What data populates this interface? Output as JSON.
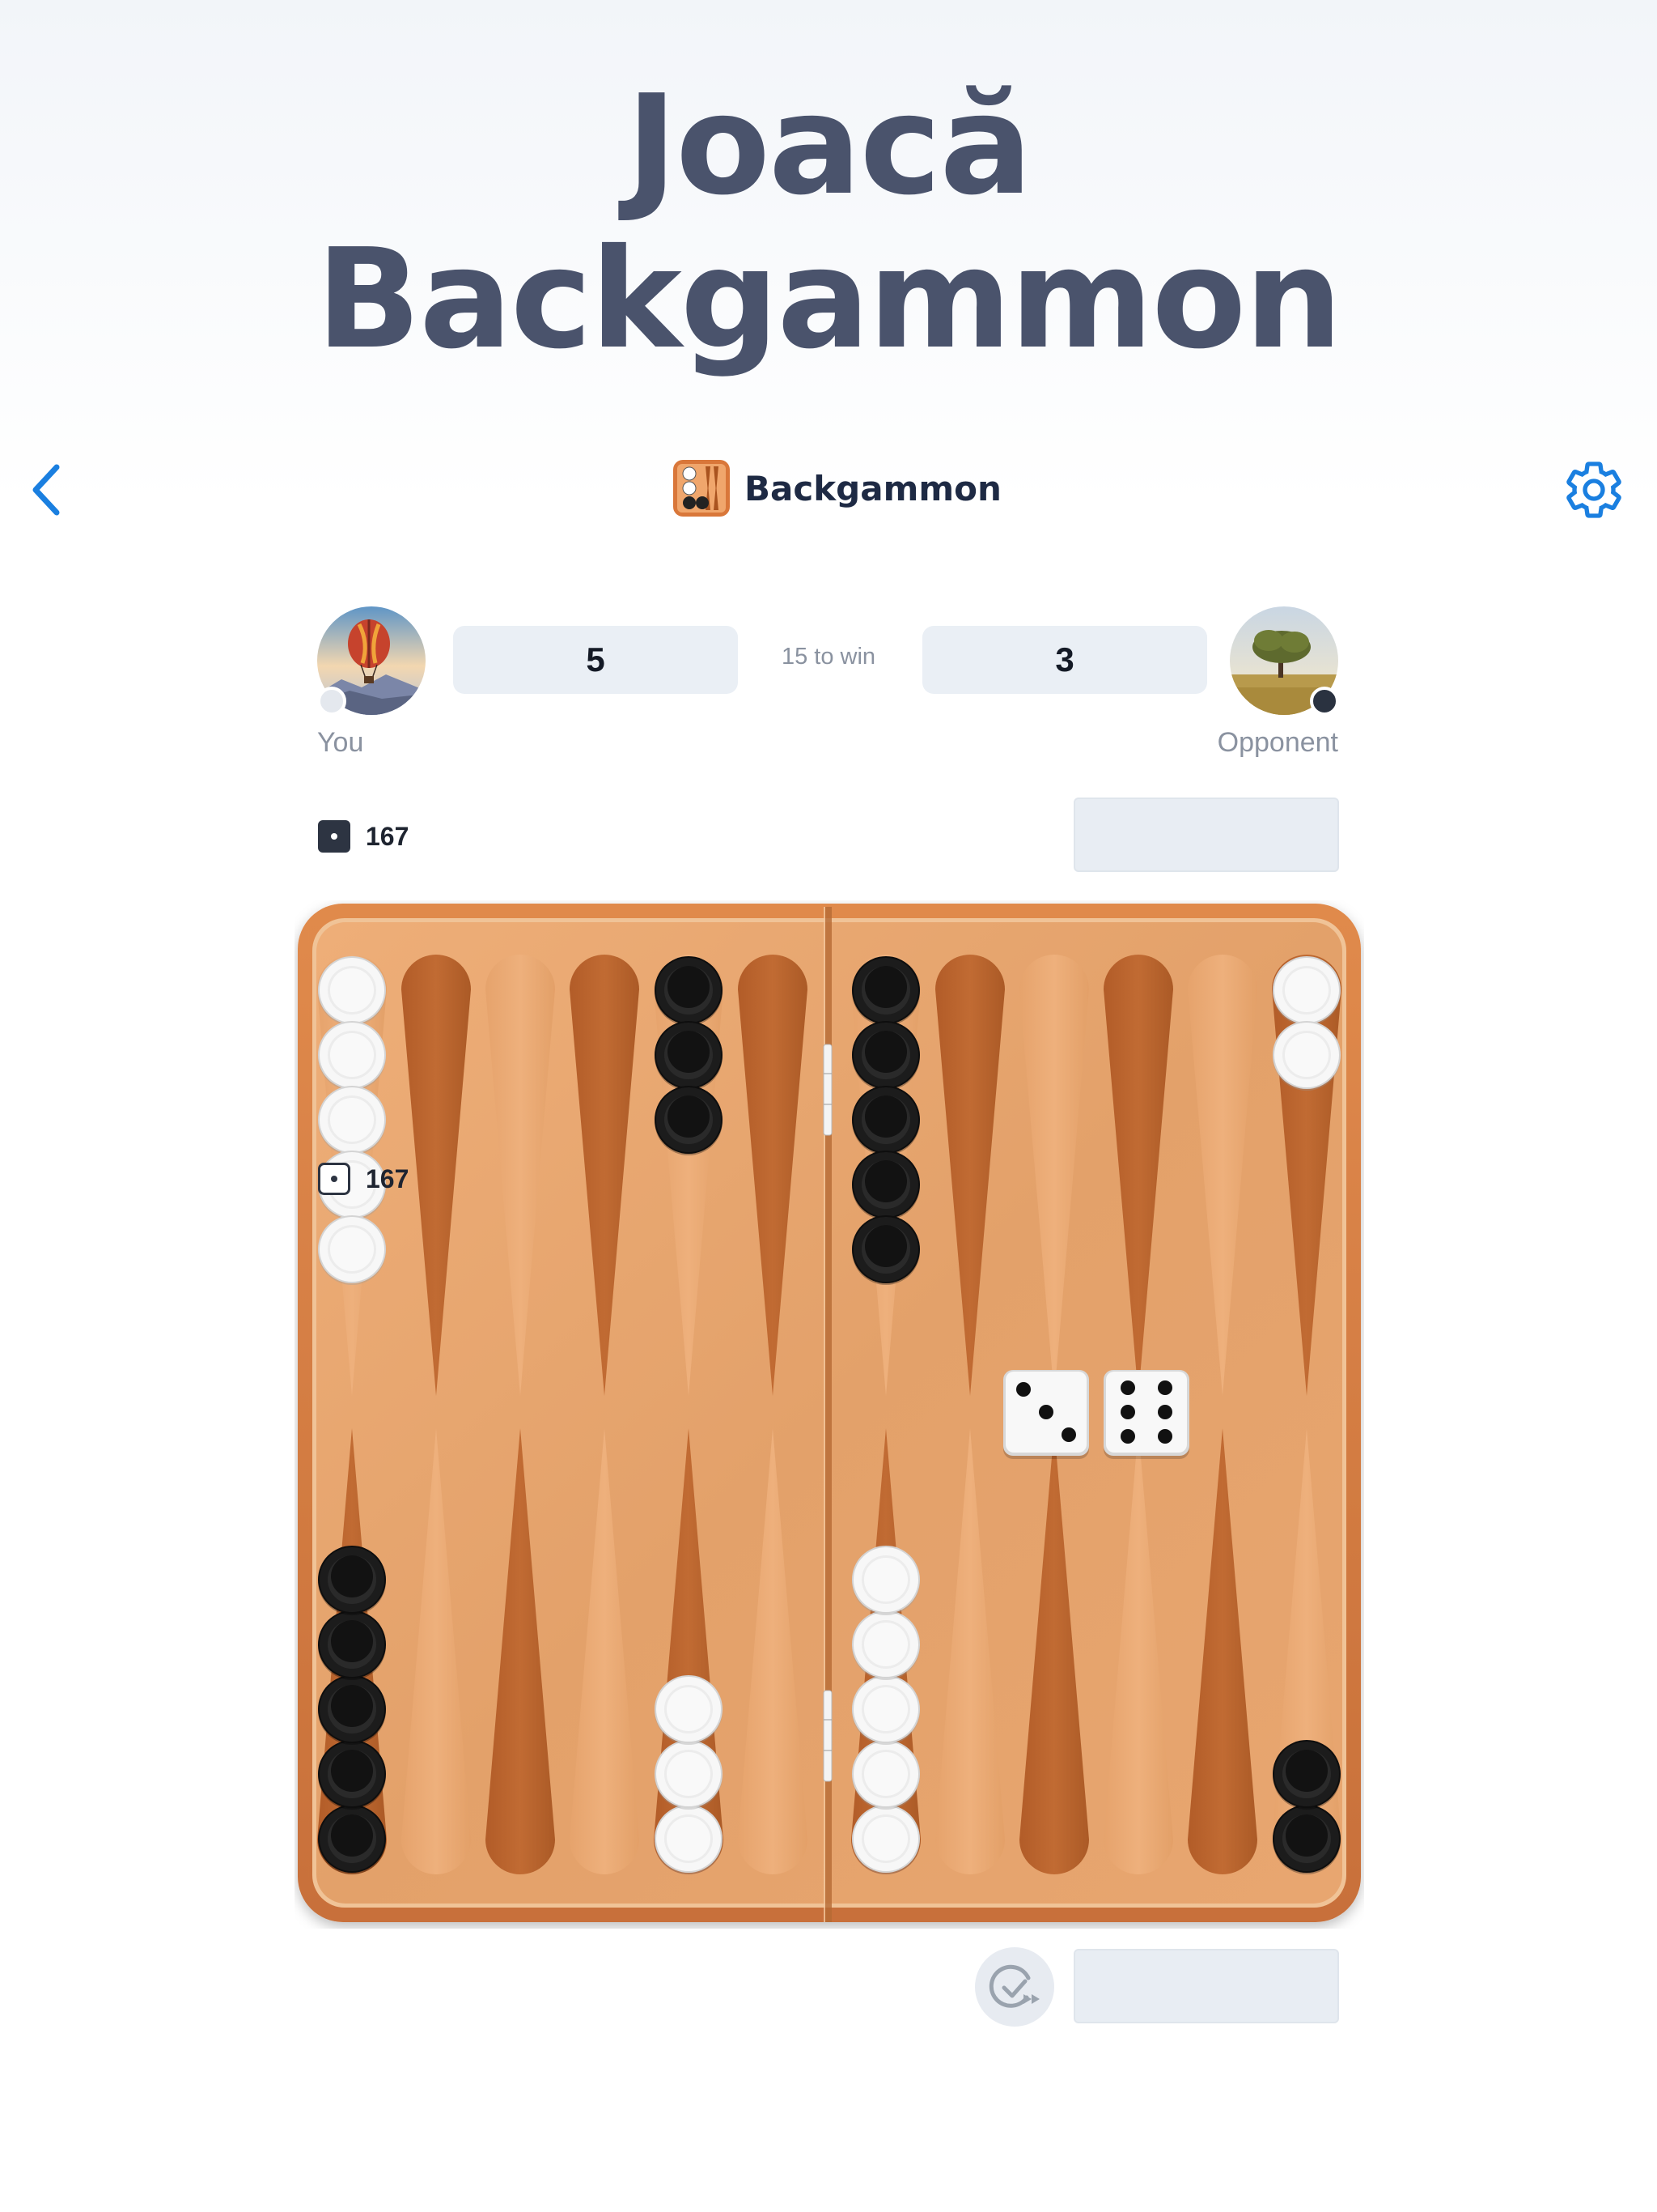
{
  "headline": {
    "line1": "Joacă",
    "line2": "Backgammon"
  },
  "nav": {
    "title": "Backgammon",
    "back_icon": "chevron-left-icon",
    "settings_icon": "gear-icon",
    "accent": "#1a7fe0"
  },
  "match": {
    "you": {
      "name": "You",
      "score": "5",
      "avatar": "hot-air-balloon"
    },
    "opponent": {
      "name": "Opponent",
      "score": "3",
      "avatar": "tree-field"
    },
    "target_label": "15 to win"
  },
  "pips": {
    "opponent": "167",
    "you": "167"
  },
  "board": {
    "colors": {
      "wood": "#e3a16a",
      "dark_point": "#b7652f",
      "light_point": "#e9a871"
    },
    "points": [
      {
        "point": 1,
        "color": "black",
        "count": 2
      },
      {
        "point": 6,
        "color": "white",
        "count": 5
      },
      {
        "point": 8,
        "color": "white",
        "count": 3
      },
      {
        "point": 12,
        "color": "black",
        "count": 5
      },
      {
        "point": 13,
        "color": "white",
        "count": 5
      },
      {
        "point": 17,
        "color": "black",
        "count": 3
      },
      {
        "point": 19,
        "color": "black",
        "count": 5
      },
      {
        "point": 24,
        "color": "white",
        "count": 2
      }
    ],
    "dice": [
      3,
      6
    ]
  }
}
